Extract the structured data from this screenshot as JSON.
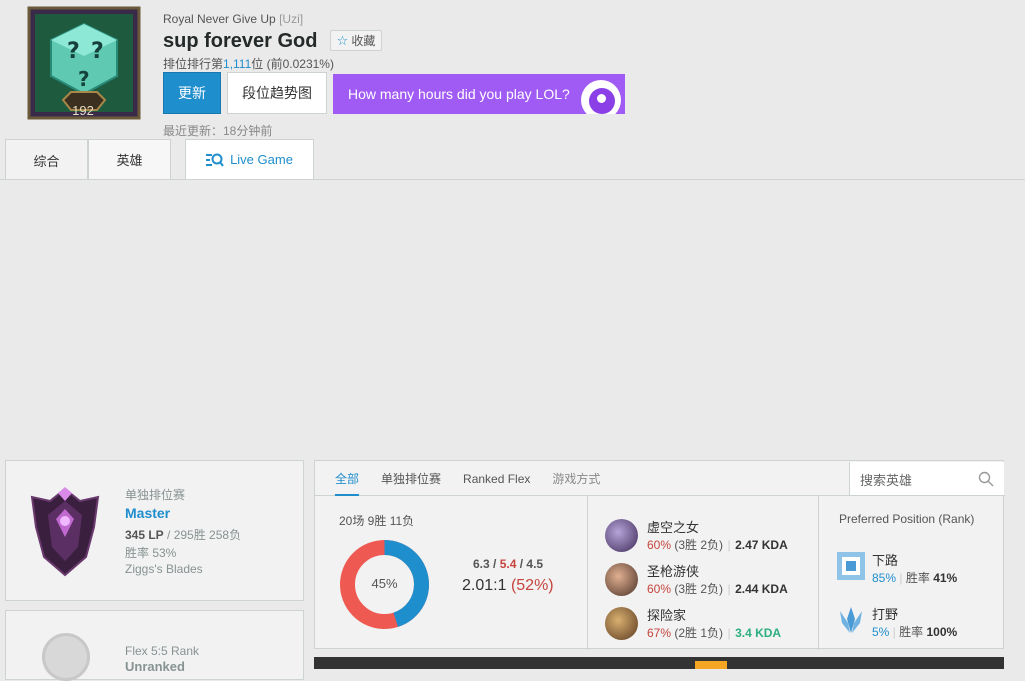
{
  "profile": {
    "level": "192",
    "team": "Royal Never Give Up",
    "team_tag": "[Uzi]",
    "summoner_name": "sup forever God",
    "favorite_label": "收藏",
    "rank_prefix": "排位排行第",
    "rank_value": "1,111",
    "rank_suffix": "位 (前0.0231%)",
    "update_button": "更新",
    "trend_button": "段位趋势图",
    "ad_text": "How many hours did you play LOL?",
    "last_updated": "最近更新：18分钟前"
  },
  "tabs": [
    {
      "label": "综合"
    },
    {
      "label": "英雄"
    },
    {
      "label": "Live Game"
    }
  ],
  "solo_rank": {
    "queue": "单独排位赛",
    "tier": "Master",
    "lp": "345 LP",
    "record": " / 295胜 258负",
    "winrate": "胜率 53%",
    "league": "Ziggs's Blades"
  },
  "flex_rank": {
    "queue": "Flex 5:5 Rank",
    "tier": "Unranked"
  },
  "stats_tabs": [
    {
      "label": "全部"
    },
    {
      "label": "单独排位赛"
    },
    {
      "label": "Ranked Flex"
    },
    {
      "label": "游戏方式"
    }
  ],
  "search": {
    "placeholder": "搜索英雄"
  },
  "summary": {
    "games": "20场 9胜 11负",
    "winrate_label": "45%",
    "win_fraction": 0.45,
    "kills": "6.3",
    "deaths": "5.4",
    "assists": "4.5",
    "kda": "2.01:1",
    "kill_participation": "(52%)"
  },
  "champions": [
    {
      "name": "虚空之女",
      "winrate": "60%",
      "record": "(3胜 2负)",
      "kda": "2.47 KDA"
    },
    {
      "name": "圣枪游侠",
      "winrate": "60%",
      "record": "(3胜 2负)",
      "kda": "2.44 KDA"
    },
    {
      "name": "探险家",
      "winrate": "67%",
      "record": "(2胜 1负)",
      "kda": "3.4 KDA"
    }
  ],
  "positions": {
    "title": "Preferred Position (Rank)",
    "items": [
      {
        "name": "下路",
        "share": "85%",
        "winrate_label": "胜率",
        "winrate": "41%"
      },
      {
        "name": "打野",
        "share": "5%",
        "winrate_label": "胜率",
        "winrate": "100%"
      }
    ]
  },
  "colors": {
    "accent": "#1f8ecd",
    "loss": "#ee5a52",
    "win": "#1f8ecd",
    "ad": "#a15bf5"
  }
}
